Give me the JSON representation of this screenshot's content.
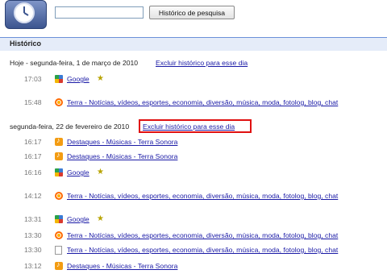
{
  "search": {
    "placeholder": "",
    "value": "",
    "button_label": "Histórico de pesquisa"
  },
  "section": {
    "title": "Histórico"
  },
  "days": [
    {
      "header": "Hoje - segunda-feira, 1 de março de 2010",
      "delete_label": "Excluir histórico para esse dia",
      "entries": [
        {
          "time": "17:03",
          "icon": "google-icon",
          "title": "Google",
          "starred": true
        },
        {
          "time": "15:48",
          "icon": "terra-icon",
          "title": "Terra - Notícias, vídeos, esportes, economia, diversão, música, moda, fotolog, blog, chat",
          "starred": false
        }
      ]
    },
    {
      "header": "segunda-feira, 22 de fevereiro de 2010",
      "delete_label": "Excluir histórico para esse dia",
      "entries": [
        {
          "time": "16:17",
          "icon": "terra-sonora-icon",
          "title": "Destaques - Músicas - Terra Sonora",
          "starred": false
        },
        {
          "time": "16:17",
          "icon": "terra-sonora-icon",
          "title": "Destaques - Músicas - Terra Sonora",
          "starred": false
        },
        {
          "time": "16:16",
          "icon": "google-icon",
          "title": "Google",
          "starred": true
        },
        {
          "time": "14:12",
          "icon": "terra-icon",
          "title": "Terra - Notícias, vídeos, esportes, economia, diversão, música, moda, fotolog, blog, chat",
          "starred": false
        },
        {
          "time": "13:31",
          "icon": "google-icon",
          "title": "Google",
          "starred": true
        },
        {
          "time": "13:30",
          "icon": "terra-icon",
          "title": "Terra - Notícias, vídeos, esportes, economia, diversão, música, moda, fotolog, blog, chat",
          "starred": false
        },
        {
          "time": "13:30",
          "icon": "page-icon",
          "title": "Terra - Notícias, vídeos, esportes, economia, diversão, música, moda, fotolog, blog, chat",
          "starred": false
        },
        {
          "time": "13:12",
          "icon": "terra-sonora-icon",
          "title": "Destaques - Músicas - Terra Sonora",
          "starred": false
        }
      ]
    }
  ],
  "colors": {
    "link": "#1a1aa6",
    "section_bg": "#e5ecf9",
    "highlight": "#e01010"
  }
}
